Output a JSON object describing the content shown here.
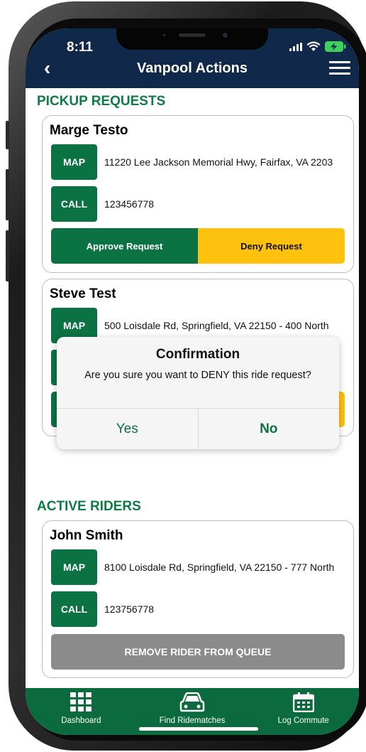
{
  "status_bar": {
    "time": "8:11"
  },
  "header": {
    "title": "Vanpool Actions",
    "back_icon": "‹"
  },
  "pickup_requests": {
    "section_title": "PICKUP REQUESTS",
    "cards": [
      {
        "name": "Marge Testo",
        "map_label": "MAP",
        "address": "11220 Lee Jackson Memorial Hwy, Fairfax, VA 2203",
        "call_label": "CALL",
        "phone": "123456778",
        "approve_label": "Approve Request",
        "deny_label": "Deny Request"
      },
      {
        "name": "Steve Test",
        "map_label": "MAP",
        "address": "500 Loisdale Rd, Springfield, VA 22150 - 400 North"
      }
    ]
  },
  "dialog": {
    "title": "Confirmation",
    "message": "Are you sure you want to DENY this ride request?",
    "yes_label": "Yes",
    "no_label": "No"
  },
  "active_riders": {
    "section_title": "ACTIVE RIDERS",
    "cards": [
      {
        "name": "John Smith",
        "map_label": "MAP",
        "address": "8100 Loisdale Rd, Springfield, VA 22150 - 777 North",
        "call_label": "CALL",
        "phone": "123756778",
        "remove_label": "REMOVE RIDER FROM QUEUE"
      }
    ]
  },
  "bottom_nav": {
    "items": [
      {
        "label": "Dashboard",
        "icon": "grid-icon"
      },
      {
        "label": "Find Ridematches",
        "icon": "car-icon"
      },
      {
        "label": "Log Commute",
        "icon": "calendar-icon"
      }
    ]
  },
  "colors": {
    "header_bg": "#10294a",
    "brand_green": "#0b7243",
    "deny_yellow": "#fec10d",
    "disabled_gray": "#8b8b8b",
    "nav_bg": "#0b6b3e"
  }
}
